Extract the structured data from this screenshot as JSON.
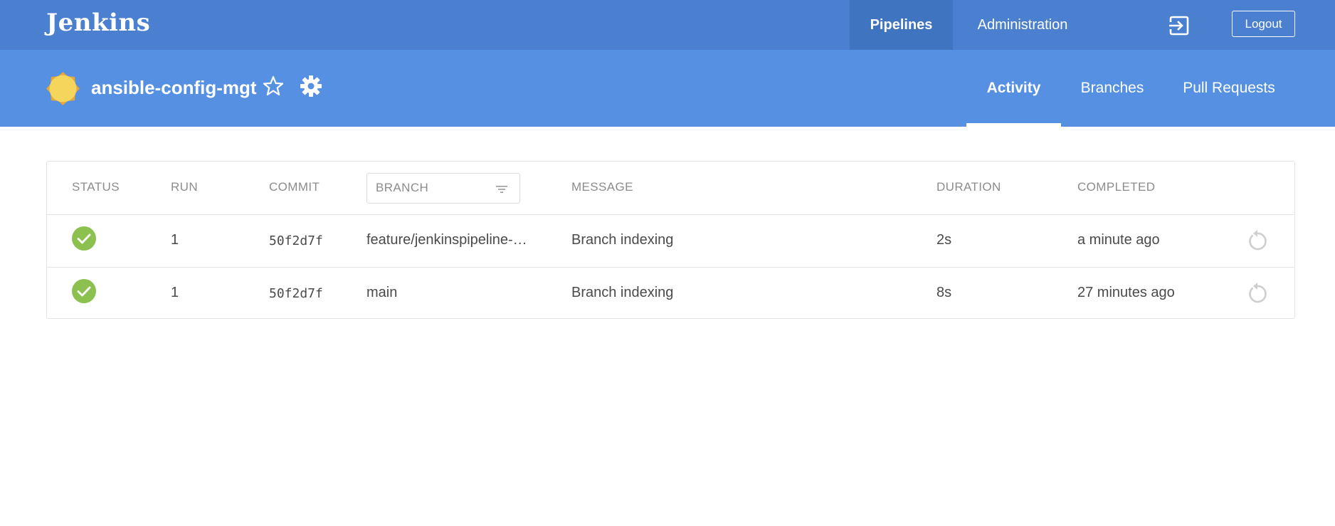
{
  "topbar": {
    "brand": "Jenkins",
    "nav": [
      {
        "label": "Pipelines",
        "active": true
      },
      {
        "label": "Administration",
        "active": false
      }
    ],
    "logout_label": "Logout",
    "login_icon": "login-arrow-icon"
  },
  "pipeline": {
    "title": "ansible-config-mgt",
    "weather_icon": "sunny-weather-icon",
    "favorite_icon": "star-icon",
    "settings_icon": "gear-icon",
    "tabs": [
      {
        "label": "Activity",
        "active": true
      },
      {
        "label": "Branches",
        "active": false
      },
      {
        "label": "Pull Requests",
        "active": false
      }
    ]
  },
  "table": {
    "headers": {
      "status": "STATUS",
      "run": "RUN",
      "commit": "COMMIT",
      "branch": "BRANCH",
      "message": "MESSAGE",
      "duration": "DURATION",
      "completed": "COMPLETED"
    },
    "rows": [
      {
        "status": "success",
        "run": "1",
        "commit": "50f2d7f",
        "branch": "feature/jenkinspipeline-…",
        "message": "Branch indexing",
        "duration": "2s",
        "completed": "a minute ago"
      },
      {
        "status": "success",
        "run": "1",
        "commit": "50f2d7f",
        "branch": "main",
        "message": "Branch indexing",
        "duration": "8s",
        "completed": "27 minutes ago"
      }
    ]
  },
  "colors": {
    "topbar": "#4a80cf",
    "header": "#5590e3",
    "success": "#8cc04f",
    "sun": "#f6d55c"
  }
}
